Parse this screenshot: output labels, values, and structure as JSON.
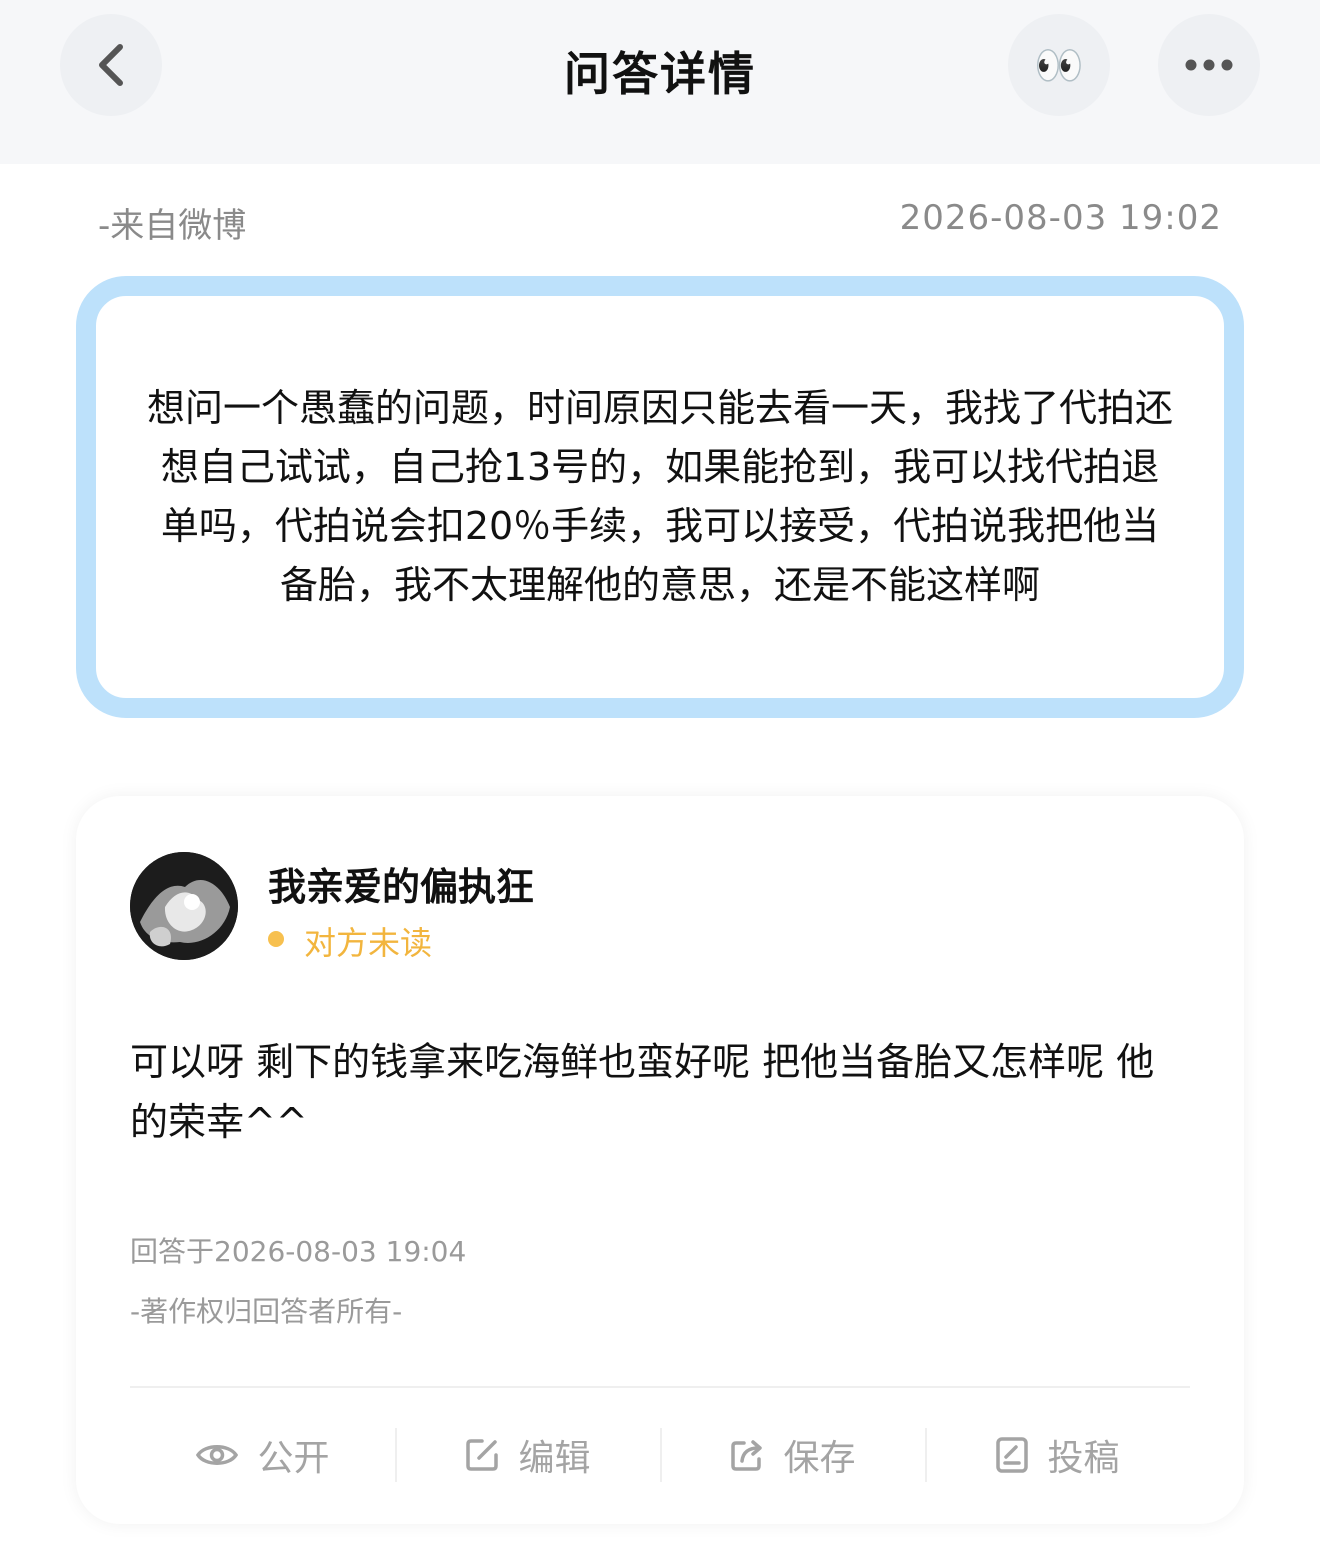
{
  "header": {
    "title": "问答详情",
    "icons": {
      "back": "chevron-left-icon",
      "eyes": "eyes-emoji-icon",
      "more": "more-dots-icon"
    },
    "eyes_emoji": "👀"
  },
  "meta": {
    "source": "-来自微博",
    "time": "2026-08-03 19:02"
  },
  "question": {
    "text": "想问一个愚蠢的问题，时间原因只能去看一天，我找了代拍还想自己试试，自己抢13号的，如果能抢到，我可以找代拍退单吗，代拍说会扣20％手续，我可以接受，代拍说我把他当备胎，我不太理解他的意思，还是不能这样啊",
    "border_color": "#bde1fb"
  },
  "answer": {
    "username": "我亲爱的偏执狂",
    "status": "对方未读",
    "status_color": "#f2b53e",
    "text": "可以呀 剩下的钱拿来吃海鲜也蛮好呢 把他当备胎又怎样呢 他的荣幸^^",
    "answered_at": "回答于2026-08-03 19:04",
    "copyright": "-著作权归回答者所有-"
  },
  "actions": [
    {
      "label": "公开",
      "icon": "eye-icon"
    },
    {
      "label": "编辑",
      "icon": "edit-icon"
    },
    {
      "label": "保存",
      "icon": "share-save-icon"
    },
    {
      "label": "投稿",
      "icon": "submit-doc-icon"
    }
  ]
}
